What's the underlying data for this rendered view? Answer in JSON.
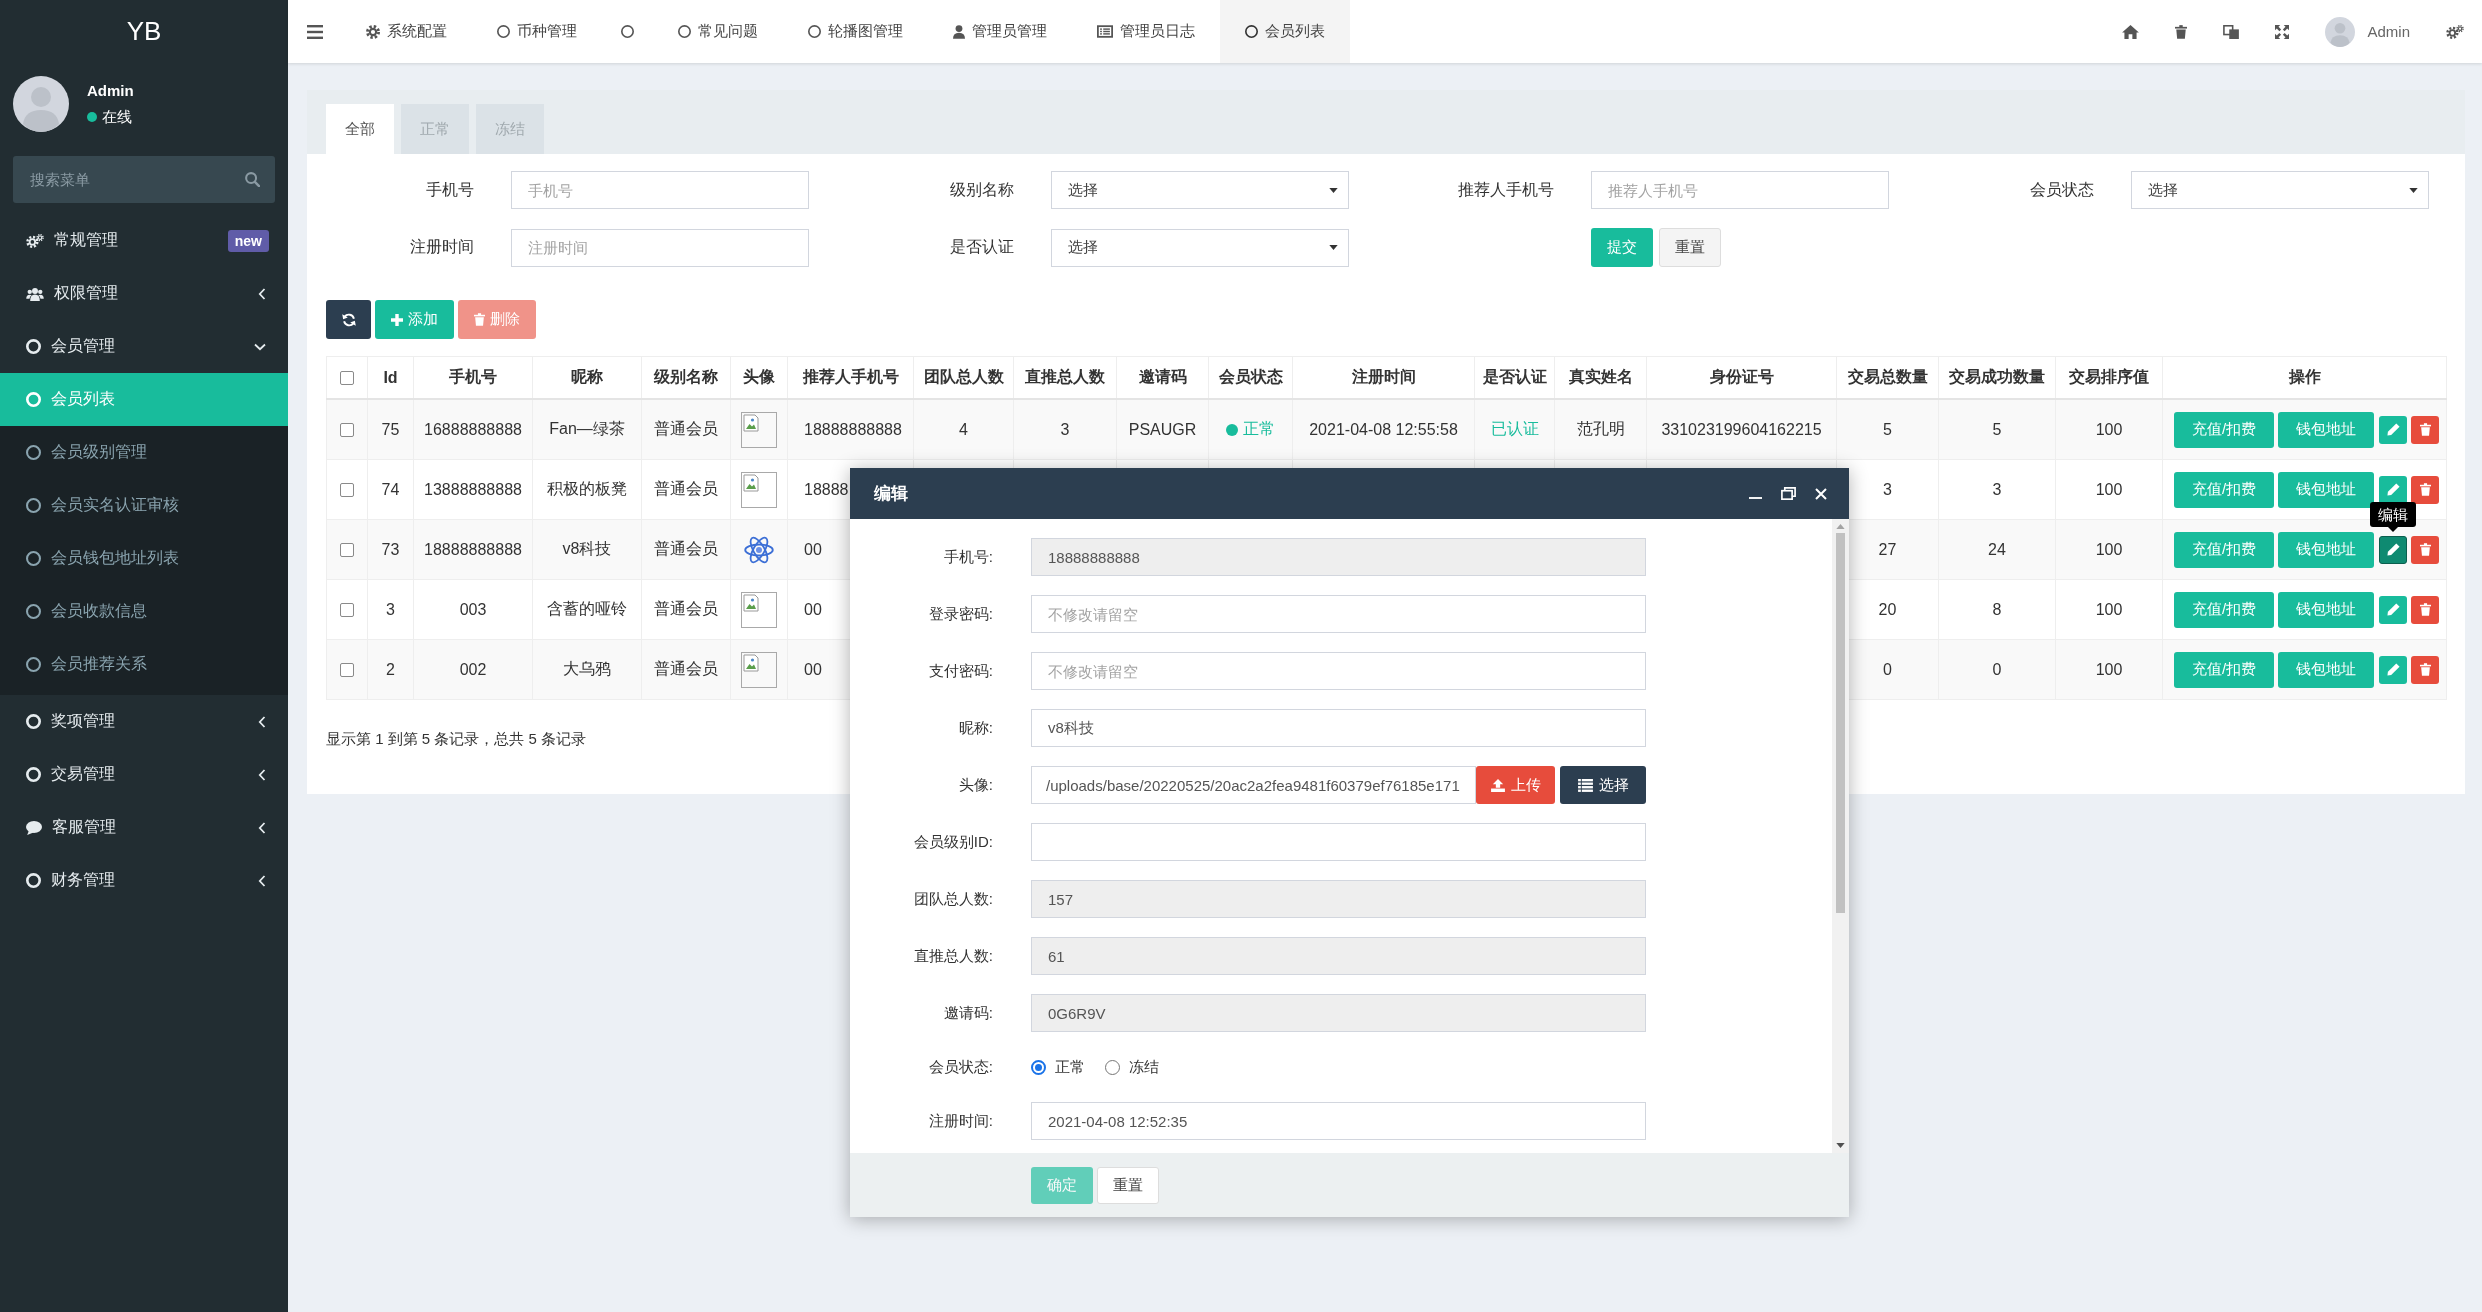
{
  "sidebar": {
    "logo": "YB",
    "user": {
      "name": "Admin",
      "status": "在线"
    },
    "search": {
      "placeholder": "搜索菜单"
    },
    "menu": [
      {
        "label": "常规管理",
        "selected": false,
        "badge": "new"
      },
      {
        "label": "权限管理",
        "selected": false,
        "expanded": false
      },
      {
        "label": "会员管理",
        "selected": false,
        "expanded": true,
        "children": [
          {
            "label": "会员列表",
            "selected": true
          },
          {
            "label": "会员级别管理",
            "selected": false
          },
          {
            "label": "会员实名认证审核",
            "selected": false
          },
          {
            "label": "会员钱包地址列表",
            "selected": false
          },
          {
            "label": "会员收款信息",
            "selected": false
          },
          {
            "label": "会员推荐关系",
            "selected": false
          }
        ]
      },
      {
        "label": "奖项管理",
        "selected": false,
        "expanded": false
      },
      {
        "label": "交易管理",
        "selected": false,
        "expanded": false
      },
      {
        "label": "客服管理",
        "selected": false,
        "expanded": false
      },
      {
        "label": "财务管理",
        "selected": false,
        "expanded": false
      }
    ]
  },
  "topbar": {
    "tabs": [
      {
        "label": "系统配置",
        "selected": false
      },
      {
        "label": "币种管理",
        "selected": false
      },
      {
        "selected": false
      },
      {
        "label": "常见问题",
        "selected": false
      },
      {
        "label": "轮播图管理",
        "selected": false
      },
      {
        "label": "管理员管理",
        "selected": false
      },
      {
        "label": "管理员日志",
        "selected": false
      },
      {
        "label": "会员列表",
        "selected": true
      }
    ],
    "user": {
      "name": "Admin"
    }
  },
  "content": {
    "tabs": [
      {
        "label": "全部",
        "selected": true
      },
      {
        "label": "正常",
        "selected": false
      },
      {
        "label": "冻结",
        "selected": false
      }
    ],
    "filters": [
      {
        "label": "手机号",
        "kind": "input",
        "placeholder": "手机号"
      },
      {
        "label": "级别名称",
        "kind": "select",
        "value": "选择"
      },
      {
        "label": "推荐人手机号",
        "kind": "input",
        "placeholder": "推荐人手机号"
      },
      {
        "label": "会员状态",
        "kind": "select",
        "value": "选择"
      },
      {
        "label": "注册时间",
        "kind": "input",
        "placeholder": "注册时间"
      },
      {
        "label": "是否认证",
        "kind": "select",
        "value": "选择"
      }
    ],
    "filter_buttons": [
      {
        "label": "提交",
        "kind": "primary"
      },
      {
        "label": "重置",
        "kind": "default"
      }
    ],
    "toolbar": [
      {
        "kind": "refresh",
        "disabled": false
      },
      {
        "kind": "add",
        "label": "添加",
        "disabled": false
      },
      {
        "kind": "delete",
        "label": "删除",
        "disabled": true
      }
    ],
    "table": {
      "select_all_checked": false,
      "columns": [
        "Id",
        "手机号",
        "昵称",
        "级别名称",
        "头像",
        "推荐人手机号",
        "团队总人数",
        "直推总人数",
        "邀请码",
        "会员状态",
        "注册时间",
        "是否认证",
        "真实姓名",
        "身份证号",
        "交易总数量",
        "交易成功数量",
        "交易排序值",
        "操作"
      ],
      "rows": [
        {
          "checked": false,
          "id": "75",
          "phone": "16888888888",
          "nickname": "Fan—绿茶",
          "level": "普通会员",
          "avatar": {
            "kind": "broken"
          },
          "referrer": "18888888888",
          "team_total": "4",
          "direct_total": "3",
          "invite_code": "PSAUGR",
          "status": "正常",
          "registered": "2021-04-08 12:55:58",
          "verified": "已认证",
          "real_name": "范孔明",
          "id_number": "331023199604162215",
          "trade_total": "5",
          "trade_success": "5",
          "trade_sort": "100",
          "actions": {
            "recharge": "充值/扣费",
            "wallet": "钱包地址",
            "edit_hover": false
          }
        },
        {
          "checked": false,
          "id": "74",
          "phone": "13888888888",
          "nickname": "积极的板凳",
          "level": "普通会员",
          "avatar": {
            "kind": "broken"
          },
          "referrer": "18888",
          "trade_total": "3",
          "trade_success": "3",
          "trade_sort": "100",
          "actions": {
            "recharge": "充值/扣费",
            "wallet": "钱包地址",
            "edit_hover": false
          }
        },
        {
          "checked": false,
          "id": "73",
          "phone": "18888888888",
          "nickname": "v8科技",
          "level": "普通会员",
          "avatar": {
            "kind": "logo"
          },
          "referrer": "00",
          "trade_total": "27",
          "trade_success": "24",
          "trade_sort": "100",
          "actions": {
            "recharge": "充值/扣费",
            "wallet": "钱包地址",
            "edit_hover": true,
            "edit_tooltip": "编辑"
          }
        },
        {
          "checked": false,
          "id": "3",
          "phone": "003",
          "nickname": "含蓄的哑铃",
          "level": "普通会员",
          "avatar": {
            "kind": "broken"
          },
          "referrer": "00",
          "trade_total": "20",
          "trade_success": "8",
          "trade_sort": "100",
          "actions": {
            "recharge": "充值/扣费",
            "wallet": "钱包地址",
            "edit_hover": false
          }
        },
        {
          "checked": false,
          "id": "2",
          "phone": "002",
          "nickname": "大乌鸦",
          "level": "普通会员",
          "avatar": {
            "kind": "broken"
          },
          "referrer": "00",
          "trade_total": "0",
          "trade_success": "0",
          "trade_sort": "100",
          "actions": {
            "recharge": "充值/扣费",
            "wallet": "钱包地址",
            "edit_hover": false
          }
        }
      ]
    },
    "summary": "显示第 1 到第 5 条记录，总共 5 条记录"
  },
  "modal": {
    "title": "编辑",
    "fields": [
      {
        "label": "手机号:",
        "kind": "input",
        "value": "18888888888",
        "readonly": true
      },
      {
        "label": "登录密码:",
        "kind": "input",
        "placeholder": "不修改请留空",
        "readonly": false
      },
      {
        "label": "支付密码:",
        "kind": "input",
        "placeholder": "不修改请留空",
        "readonly": false
      },
      {
        "label": "昵称:",
        "kind": "input",
        "value": "v8科技",
        "readonly": false
      },
      {
        "label": "头像:",
        "kind": "file",
        "value": "/uploads/base/20220525/20ac2a2fea9481f60379ef76185e171",
        "buttons": [
          {
            "kind": "upload",
            "label": "上传"
          },
          {
            "kind": "choose",
            "label": "选择"
          }
        ]
      },
      {
        "label": "会员级别ID:",
        "kind": "input",
        "readonly": false
      },
      {
        "label": "团队总人数:",
        "kind": "input",
        "value": "157",
        "readonly": true
      },
      {
        "label": "直推总人数:",
        "kind": "input",
        "value": "61",
        "readonly": true
      },
      {
        "label": "邀请码:",
        "kind": "input",
        "value": "0G6R9V",
        "readonly": true
      },
      {
        "label": "会员状态:",
        "kind": "radio",
        "options": [
          {
            "label": "正常",
            "selected": true
          },
          {
            "label": "冻结",
            "selected": false
          }
        ]
      },
      {
        "label": "注册时间:",
        "kind": "input",
        "value": "2021-04-08 12:52:35",
        "readonly": false
      }
    ],
    "buttons": [
      {
        "label": "确定",
        "kind": "primary",
        "disabled": true
      },
      {
        "label": "重置",
        "kind": "default",
        "disabled": false
      }
    ]
  }
}
